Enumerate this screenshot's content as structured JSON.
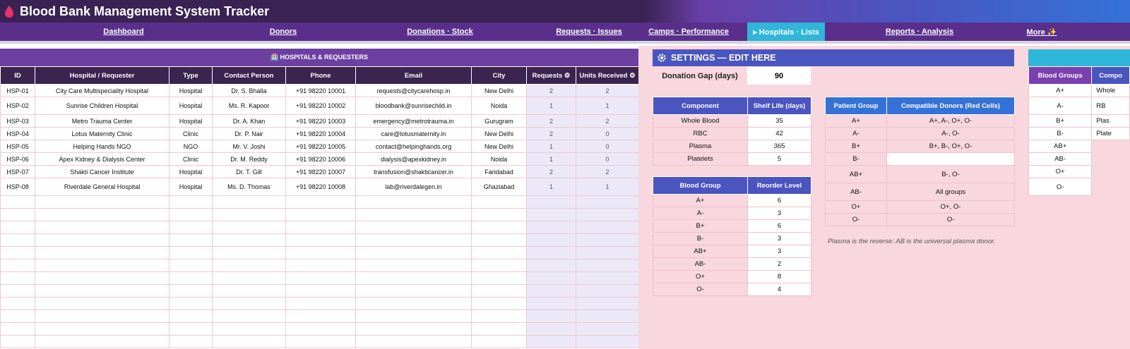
{
  "app": {
    "title": "Blood Bank Management System Tracker"
  },
  "nav": [
    {
      "label": "Dashboard",
      "active": false
    },
    {
      "label": "Donors",
      "active": false
    },
    {
      "label": "Donations · Stock",
      "active": false
    },
    {
      "label": "Requests · Issues",
      "active": false
    },
    {
      "label": "Camps · Performance",
      "active": false
    },
    {
      "label": "▸ Hospitals · Lists",
      "active": true
    },
    {
      "label": "Reports · Analysis",
      "active": false
    },
    {
      "label": "More ✨",
      "active": false
    }
  ],
  "hospitals": {
    "banner": "🏥 HOSPITALS & REQUESTERS",
    "headers": [
      "ID",
      "Hospital / Requester",
      "Type",
      "Contact Person",
      "Phone",
      "Email",
      "City",
      "Requests ⚙",
      "Units Received ⚙"
    ],
    "rows": [
      [
        "HSP-01",
        "City Care Multispeciality Hospital",
        "Hospital",
        "Dr. S. Bhalla",
        "+91 98220 10001",
        "requests@citycarehosp.in",
        "New Delhi",
        "2",
        "2"
      ],
      [
        "HSP-02",
        "Sunrise Children Hospital",
        "Hospital",
        "Ms. R. Kapoor",
        "+91 98220 10002",
        "bloodbank@sunrisechild.in",
        "Noida",
        "1",
        "1"
      ],
      [
        "HSP-03",
        "Metro Trauma Center",
        "Hospital",
        "Dr. A. Khan",
        "+91 98220 10003",
        "emergency@metrotrauma.in",
        "Gurugram",
        "2",
        "2"
      ],
      [
        "HSP-04",
        "Lotus Maternity Clinic",
        "Clinic",
        "Dr. P. Nair",
        "+91 98220 10004",
        "care@lotusmaternity.in",
        "New Delhi",
        "2",
        "0"
      ],
      [
        "HSP-05",
        "Helping Hands NGO",
        "NGO",
        "Mr. V. Joshi",
        "+91 98220 10005",
        "contact@helpinghands.org",
        "New Delhi",
        "1",
        "0"
      ],
      [
        "HSP-06",
        "Apex Kidney & Dialysis Center",
        "Clinic",
        "Dr. M. Reddy",
        "+91 98220 10006",
        "dialysis@apexkidney.in",
        "Noida",
        "1",
        "0"
      ],
      [
        "HSP-07",
        "Shakti Cancer Institute",
        "Hospital",
        "Dr. T. Gill",
        "+91 98220 10007",
        "transfusion@shakticancer.in",
        "Faridabad",
        "2",
        "2"
      ],
      [
        "HSP-08",
        "Riverdale General Hospital",
        "Hospital",
        "Ms. D. Thomas",
        "+91 98220 10008",
        "lab@riverdalegen.in",
        "Ghaziabad",
        "1",
        "1"
      ]
    ]
  },
  "settings": {
    "title": "SETTINGS — EDIT HERE",
    "donation_gap_label": "Donation Gap (days)",
    "donation_gap_value": "90",
    "shelf": {
      "headers": [
        "Component",
        "Shelf Life (days)"
      ],
      "rows": [
        [
          "Whole Blood",
          "35"
        ],
        [
          "RBC",
          "42"
        ],
        [
          "Plasma",
          "365"
        ],
        [
          "Platelets",
          "5"
        ]
      ]
    },
    "reorder": {
      "headers": [
        "Blood Group",
        "Reorder Level"
      ],
      "rows": [
        [
          "A+",
          "6"
        ],
        [
          "A-",
          "3"
        ],
        [
          "B+",
          "6"
        ],
        [
          "B-",
          "3"
        ],
        [
          "AB+",
          "3"
        ],
        [
          "AB-",
          "2"
        ],
        [
          "O+",
          "8"
        ],
        [
          "O-",
          "4"
        ]
      ]
    },
    "compat": {
      "headers": [
        "Patient Group",
        "Compatible Donors (Red Cells)"
      ],
      "rows": [
        [
          "A+",
          "A+, A-, O+, O-"
        ],
        [
          "A-",
          "A-, O-"
        ],
        [
          "B+",
          "B+, B-, O+, O-"
        ],
        [
          "B-",
          ""
        ],
        [
          "AB+",
          "B-, O-"
        ],
        [
          "AB-",
          "All groups"
        ],
        [
          "O+",
          "O+, O-"
        ],
        [
          "O-",
          "O-"
        ]
      ]
    },
    "note": "Plasma is the reverse: AB is the universal plasma donor."
  },
  "lists": {
    "headers": [
      "Blood Groups",
      "Compo"
    ],
    "blood_groups": [
      "A+",
      "A-",
      "B+",
      "B-",
      "AB+",
      "AB-",
      "O+",
      "O-"
    ],
    "components": [
      "Whole",
      "RB",
      "Plas",
      "Plate"
    ]
  },
  "colors": {
    "title_bar": "#3a2353",
    "nav": "#5a2f8c",
    "active_tab": "#2fb6d8",
    "settings_blue": "#4a55c0",
    "settings_bg": "#f8d7de"
  }
}
